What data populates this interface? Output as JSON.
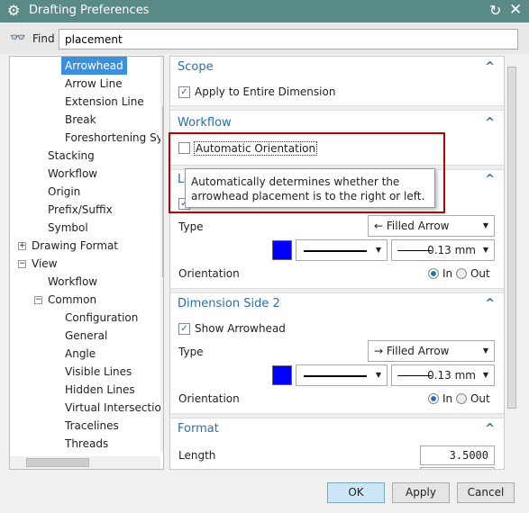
{
  "window": {
    "title": "Drafting Preferences",
    "icons": [
      "gear-icon",
      "reset-icon",
      "close-icon"
    ]
  },
  "find": {
    "label": "Find",
    "value": "placement"
  },
  "tree": [
    {
      "label": "Arrowhead",
      "level": 4,
      "selected": true
    },
    {
      "label": "Arrow Line",
      "level": 4
    },
    {
      "label": "Extension Line",
      "level": 4
    },
    {
      "label": "Break",
      "level": 4
    },
    {
      "label": "Foreshortening Sy",
      "level": 4
    },
    {
      "label": "Stacking",
      "level": 3
    },
    {
      "label": "Workflow",
      "level": 3
    },
    {
      "label": "Origin",
      "level": 3
    },
    {
      "label": "Prefix/Suffix",
      "level": 3
    },
    {
      "label": "Symbol",
      "level": 3
    },
    {
      "label": "Drawing Format",
      "level": 1,
      "expander": "+"
    },
    {
      "label": "View",
      "level": 1,
      "expander": "-"
    },
    {
      "label": "Workflow",
      "level": 3
    },
    {
      "label": "Common",
      "level": 3,
      "expander": "-"
    },
    {
      "label": "Configuration",
      "level": 4
    },
    {
      "label": "General",
      "level": 4
    },
    {
      "label": "Angle",
      "level": 4
    },
    {
      "label": "Visible Lines",
      "level": 4
    },
    {
      "label": "Hidden Lines",
      "level": 4
    },
    {
      "label": "Virtual Intersectio",
      "level": 4
    },
    {
      "label": "Tracelines",
      "level": 4
    },
    {
      "label": "Threads",
      "level": 4
    }
  ],
  "scope": {
    "title": "Scope",
    "apply_label": "Apply to Entire Dimension",
    "apply_checked": true
  },
  "workflow": {
    "title": "Workflow",
    "auto_label": "Automatic Orientation",
    "auto_checked": false
  },
  "tooltip": "Automatically determines whether the arrowhead placement is to the right or left.",
  "side1": {
    "title": "Leader",
    "type_label": "Type",
    "type_value": "Filled Arrow",
    "type_icon": "←",
    "color": "#0000ff",
    "width_value": "0.13 mm",
    "orientation_label": "Orientation",
    "in_label": "In",
    "out_label": "Out",
    "orientation": "In"
  },
  "side2": {
    "title": "Dimension Side 2",
    "show_label": "Show Arrowhead",
    "show_checked": true,
    "type_label": "Type",
    "type_value": "Filled Arrow",
    "type_icon": "→",
    "color": "#0000ff",
    "width_value": "0.13 mm",
    "orientation_label": "Orientation",
    "in_label": "In",
    "out_label": "Out",
    "orientation": "In"
  },
  "format": {
    "title": "Format",
    "length_label": "Length",
    "length_value": "3.5000"
  },
  "buttons": {
    "ok": "OK",
    "apply": "Apply",
    "cancel": "Cancel"
  }
}
